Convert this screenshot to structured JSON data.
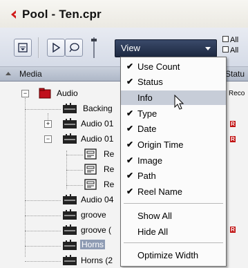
{
  "window": {
    "title": "Pool - Ten.cpr"
  },
  "toolbar": {
    "view_select": "View",
    "right_labels": [
      "All",
      "All"
    ]
  },
  "columns": {
    "media": "Media",
    "status": "Statu"
  },
  "tree": {
    "rows": [
      {
        "label": "Audio",
        "status": "Reco"
      },
      {
        "label": "Backing"
      },
      {
        "label": "Audio 01"
      },
      {
        "label": "Audio 01"
      },
      {
        "label": "Re"
      },
      {
        "label": "Re"
      },
      {
        "label": "Re"
      },
      {
        "label": "Audio 04"
      },
      {
        "label": "groove"
      },
      {
        "label": "groove ("
      },
      {
        "label": "Horns"
      },
      {
        "label": "Horns (2"
      }
    ],
    "status_badges": [
      "R",
      "R",
      "R"
    ]
  },
  "menu": {
    "check_glyph": "✔",
    "items": [
      {
        "label": "Use Count",
        "checked": true
      },
      {
        "label": "Status",
        "checked": true
      },
      {
        "label": "Info",
        "checked": false
      },
      {
        "label": "Type",
        "checked": true
      },
      {
        "label": "Date",
        "checked": true
      },
      {
        "label": "Origin Time",
        "checked": true
      },
      {
        "label": "Image",
        "checked": true
      },
      {
        "label": "Path",
        "checked": true
      },
      {
        "label": "Reel Name",
        "checked": true
      }
    ],
    "actions": [
      "Show All",
      "Hide All"
    ],
    "optimize": "Optimize Width"
  },
  "colors": {
    "accent": "#1c2840",
    "menu_highlight": "#c7cdd8",
    "badge_red": "#c01010",
    "audio_folder_red": "#c0101c"
  }
}
